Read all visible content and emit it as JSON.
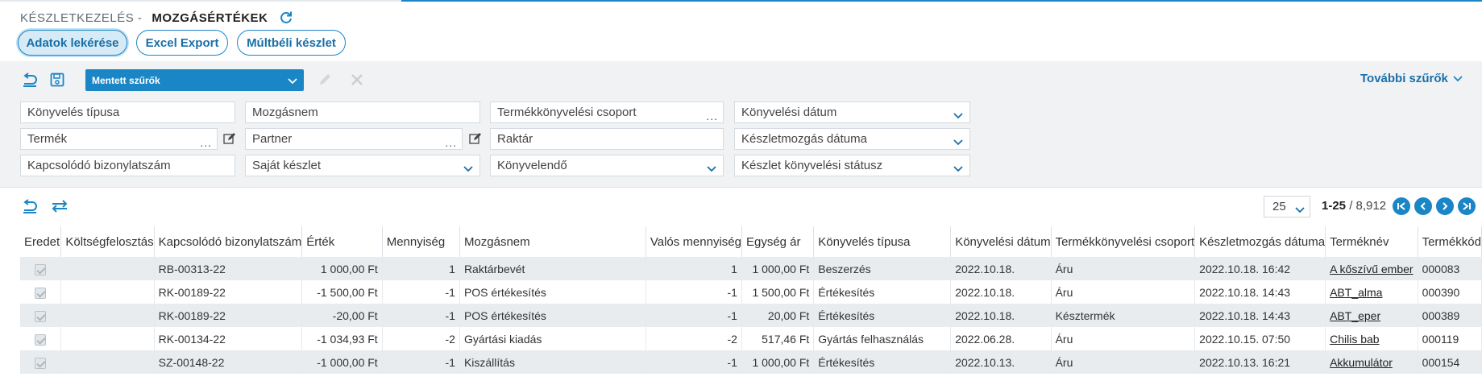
{
  "header": {
    "module": "KÉSZLETKEZELÉS -",
    "page": "MOZGÁSÉRTÉKEK",
    "refresh_icon": "refresh-icon"
  },
  "actions": {
    "fetch": "Adatok lekérése",
    "excel": "Excel Export",
    "past": "Múltbéli készlet"
  },
  "filterbar": {
    "saved_filters": "Mentett szűrők",
    "more_filters": "További szűrők"
  },
  "filters": {
    "posting_type": "Könyvelés típusa",
    "movement_name": "Mozgásnem",
    "product_posting_group": "Termékkönyvelési csoport",
    "posting_date": "Könyvelési dátum",
    "product": "Termék",
    "partner": "Partner",
    "warehouse": "Raktár",
    "movement_date": "Készletmozgás dátuma",
    "related_doc": "Kapcsolódó bizonylatszám",
    "own_stock": "Saját készlet",
    "to_post": "Könyvelendő",
    "stock_post_status": "Készlet könyvelési státusz"
  },
  "pagination": {
    "page_size": "25",
    "range": "1-25",
    "total": "/ 8,912"
  },
  "table": {
    "columns": [
      "Eredet",
      "Költségfelosztás",
      "Kapcsolódó bizonylatszám",
      "Érték",
      "Mennyiség",
      "Mozgásnem",
      "Valós mennyiség",
      "Egység ár",
      "Könyvelés típusa",
      "Könyvelési dátum",
      "Termékkönyvelési csoport",
      "Készletmozgás dátuma",
      "Terméknév",
      "Termékkód"
    ],
    "rows": [
      {
        "doc": "RB-00313-22",
        "value": "1 000,00 Ft",
        "qty": "1",
        "movement": "Raktárbevét",
        "real_qty": "1",
        "unit_price": "1 000,00 Ft",
        "post_type": "Beszerzés",
        "post_date": "2022.10.18.",
        "group": "Áru",
        "move_date": "2022.10.18. 16:42",
        "name": "A kőszívű ember",
        "code": "000083"
      },
      {
        "doc": "RK-00189-22",
        "value": "-1 500,00 Ft",
        "qty": "-1",
        "movement": "POS értékesítés",
        "real_qty": "-1",
        "unit_price": "1 500,00 Ft",
        "post_type": "Értékesítés",
        "post_date": "2022.10.18.",
        "group": "Áru",
        "move_date": "2022.10.18. 14:43",
        "name": "ABT_alma",
        "code": "000390"
      },
      {
        "doc": "RK-00189-22",
        "value": "-20,00 Ft",
        "qty": "-1",
        "movement": "POS értékesítés",
        "real_qty": "-1",
        "unit_price": "20,00 Ft",
        "post_type": "Értékesítés",
        "post_date": "2022.10.18.",
        "group": "Késztermék",
        "move_date": "2022.10.18. 14:43",
        "name": "ABT_eper",
        "code": "000389"
      },
      {
        "doc": "RK-00134-22",
        "value": "-1 034,93 Ft",
        "qty": "-2",
        "movement": "Gyártási kiadás",
        "real_qty": "-2",
        "unit_price": "517,46 Ft",
        "post_type": "Gyártás felhasználás",
        "post_date": "2022.06.28.",
        "group": "Áru",
        "move_date": "2022.10.15. 07:50",
        "name": "Chilis bab",
        "code": "000119"
      },
      {
        "doc": "SZ-00148-22",
        "value": "-1 000,00 Ft",
        "qty": "-1",
        "movement": "Kiszállítás",
        "real_qty": "-1",
        "unit_price": "1 000,00 Ft",
        "post_type": "Értékesítés",
        "post_date": "2022.10.13.",
        "group": "Áru",
        "move_date": "2022.10.13. 16:21",
        "name": "Akkumulátor",
        "code": "000154"
      }
    ]
  }
}
